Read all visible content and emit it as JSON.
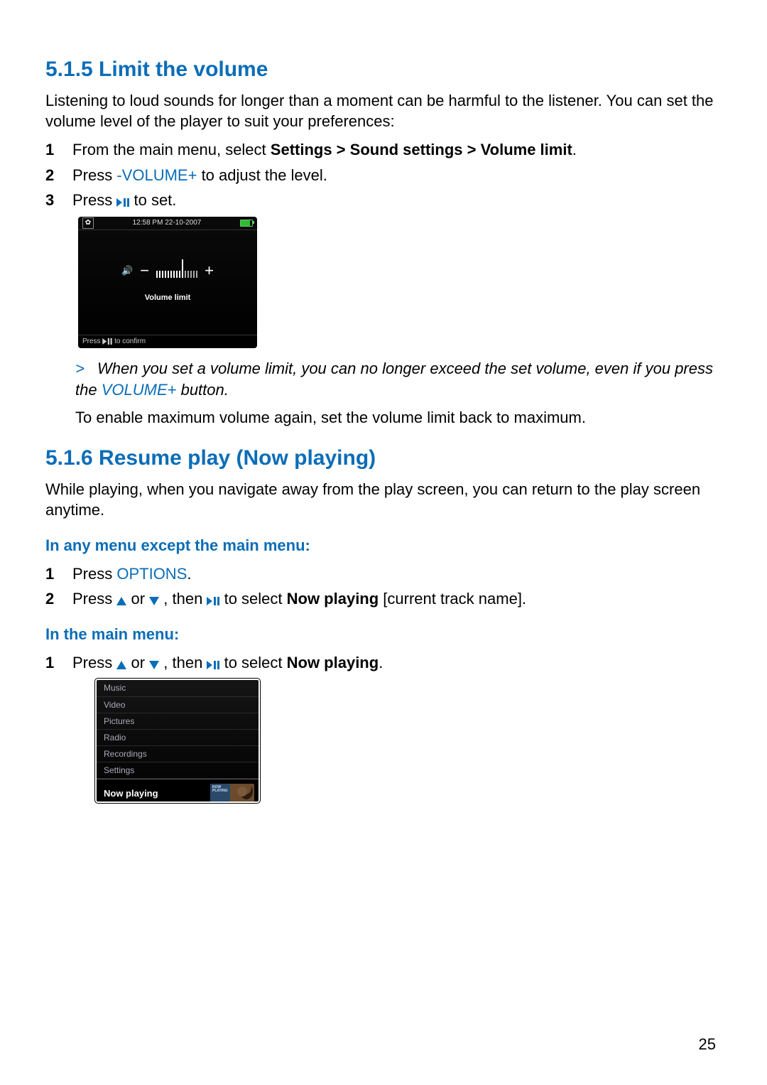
{
  "section1": {
    "heading": "5.1.5 Limit the volume",
    "intro": "Listening to loud sounds for longer than a moment can be harmful to the listener. You can set the volume level of the player to suit your preferences:",
    "steps": {
      "s1_pre": "From the main menu, select ",
      "s1_bold": "Settings > Sound settings > Volume limit",
      "s1_post": ".",
      "s2_pre": "Press ",
      "s2_btn": "-VOLUME+",
      "s2_post": " to adjust the level.",
      "s3_pre": "Press ",
      "s3_post": " to set."
    },
    "note_gt": ">",
    "note_pre": "When you set a volume limit, you can no longer exceed the set volume, even if you press the ",
    "note_btn": "VOLUME+",
    "note_post": " button.",
    "note_after": "To enable maximum volume again, set the volume limit back to maximum."
  },
  "device1": {
    "time": "12:58 PM  22-10-2007",
    "label": "Volume limit",
    "confirm_pre": "Press ",
    "confirm_post": " to confirm"
  },
  "section2": {
    "heading": "5.1.6 Resume play (Now playing)",
    "intro": "While playing, when you navigate away from the play screen, you can return to the play screen anytime.",
    "sub1": "In any menu except the main menu:",
    "a1_pre": "Press ",
    "a1_btn": "OPTIONS",
    "a1_post": ".",
    "a2_pre": "Press ",
    "a2_mid1": " or ",
    "a2_mid2": ", then ",
    "a2_mid3": " to select ",
    "a2_bold": "Now playing",
    "a2_post": " [current track name].",
    "sub2": "In the main menu:",
    "b1_pre": "Press ",
    "b1_mid1": " or ",
    "b1_mid2": ", then ",
    "b1_mid3": " to select ",
    "b1_bold": "Now playing",
    "b1_post": "."
  },
  "device2": {
    "items": [
      "Music",
      "Video",
      "Pictures",
      "Radio",
      "Recordings",
      "Settings"
    ],
    "now": "Now playing",
    "thumb_txt": "NOW\nPLAYING"
  },
  "page_num": "25"
}
